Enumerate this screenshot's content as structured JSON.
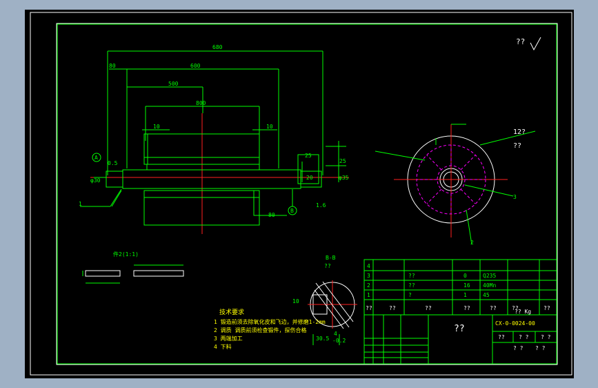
{
  "drawing": {
    "corner_mark": "?? ",
    "section_note": "B-B",
    "section_note_sub": "??",
    "detail_label": "件2(1:1)",
    "tech_title": "技术要求",
    "tech_lines": [
      "1 锻造前须去除氧化皮和飞边，并修磨1-2mm",
      "2 调质 调质前须检查锻件，探伤合格",
      "3 两端加工",
      "4 下料"
    ],
    "labels_left": [
      "1",
      "2"
    ],
    "labels_right": [
      "12?",
      "??",
      "3",
      "2"
    ],
    "section_dims": [
      "10",
      "30.5",
      "4",
      "-0.2"
    ],
    "title_block": {
      "name": "??",
      "drawing_no": "CX-0-0024-00",
      "rows_right": [
        "??",
        "? ?",
        "? ?"
      ],
      "row_bottom": [
        "? ?",
        "? ?"
      ],
      "parts_table": [
        [
          "4",
          "",
          ""
        ],
        [
          "3",
          "??",
          "0",
          "Q235"
        ],
        [
          "2",
          "??",
          "16",
          "40Mn"
        ],
        [
          "1",
          "?",
          "1",
          "45"
        ]
      ],
      "header": [
        "??",
        "??",
        "??",
        "??",
        "??",
        "??",
        "?? Kg",
        "??"
      ]
    }
  }
}
